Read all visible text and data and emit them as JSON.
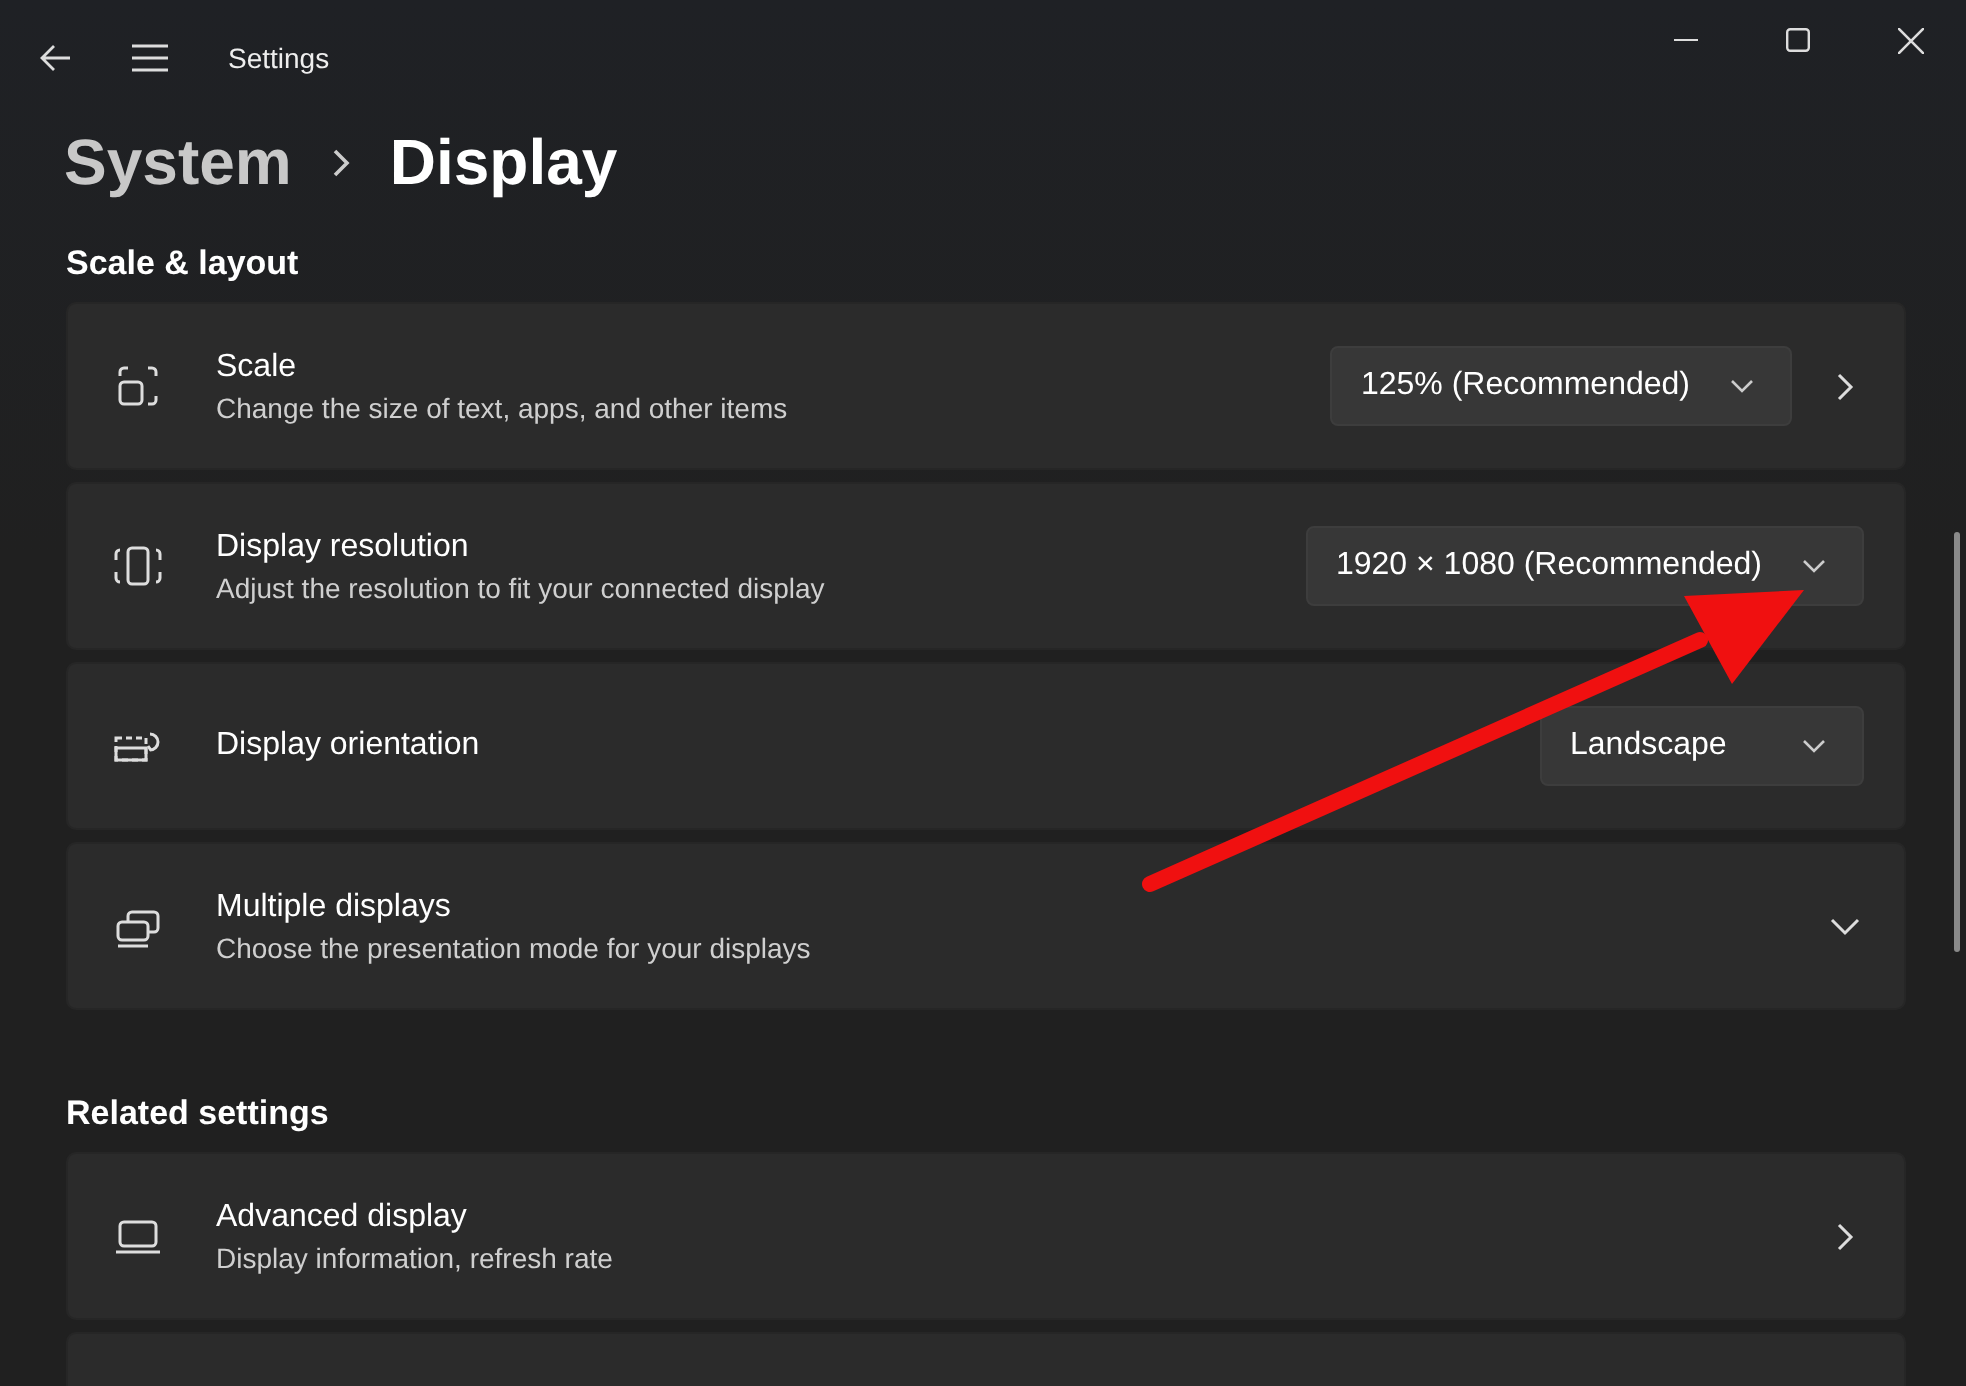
{
  "window": {
    "title": "Settings"
  },
  "breadcrumb": [
    {
      "label": "System",
      "selected": false
    },
    {
      "label": "Display",
      "selected": true
    }
  ],
  "sections": [
    {
      "title": "Scale & layout",
      "rows": [
        {
          "kind": "dropdown-link",
          "title": "Scale",
          "description": "Change the size of text, apps, and other items",
          "value": "125% (Recommended)"
        },
        {
          "kind": "dropdown",
          "title": "Display resolution",
          "description": "Adjust the resolution to fit your connected display",
          "value": "1920 × 1080 (Recommended)"
        },
        {
          "kind": "dropdown",
          "title": "Display orientation",
          "value": "Landscape"
        },
        {
          "kind": "expander",
          "title": "Multiple displays",
          "description": "Choose the presentation mode for your displays"
        }
      ]
    },
    {
      "title": "Related settings",
      "rows": [
        {
          "kind": "link",
          "title": "Advanced display",
          "description": "Display information, refresh rate"
        },
        {
          "kind": "blank"
        }
      ]
    }
  ]
}
